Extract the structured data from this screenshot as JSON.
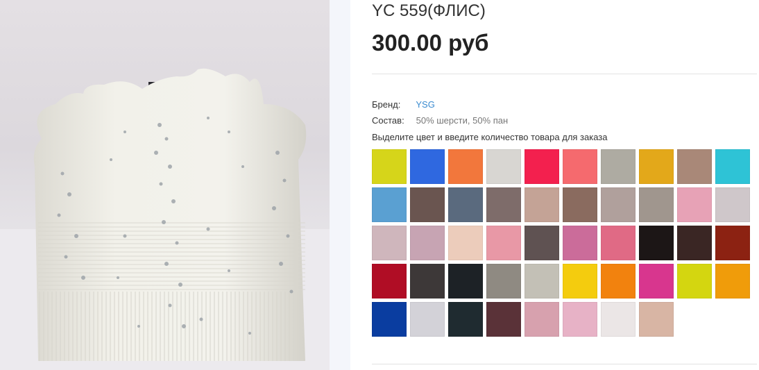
{
  "product": {
    "title": "YC 559(ФЛИС)",
    "price": "300.00 руб",
    "brand_label": "Бренд:",
    "brand_value": "YSG",
    "composition_label": "Состав:",
    "composition_value": "50% шерсти, 50% пан",
    "instruction": "Выделите цвет и введите количество товара для заказа"
  },
  "colors": {
    "swatches": [
      "#d6d51a",
      "#2f68e0",
      "#f2773c",
      "#d8d6d2",
      "#f3204e",
      "#f56a6e",
      "#aeaba2",
      "#e3a81a",
      "#a98878",
      "#2ec3d6",
      "#5aa0d2",
      "#6a5550",
      "#5a6a7e",
      "#7e6c6a",
      "#c4a396",
      "#8a6b5f",
      "#b0a09c",
      "#a0968e",
      "#e7a2b6",
      "#cfc7ca",
      "#cfb6bc",
      "#c7a4b3",
      "#ecccbb",
      "#e898a6",
      "#5f5252",
      "#cb6c9a",
      "#e06a85",
      "#1c1616",
      "#3a2624",
      "#8c2212",
      "#b00d25",
      "#3d3838",
      "#1d2226",
      "#8f8a82",
      "#c3c0b6",
      "#f4cc0e",
      "#f2820e",
      "#d8368e",
      "#d4d610",
      "#f09c0a",
      "#0a3da0",
      "#d3d2d8",
      "#1f2b30",
      "#5a3238",
      "#d7a1ae",
      "#e7b2c6",
      "#ebe6e6",
      "#d8b5a4"
    ]
  }
}
